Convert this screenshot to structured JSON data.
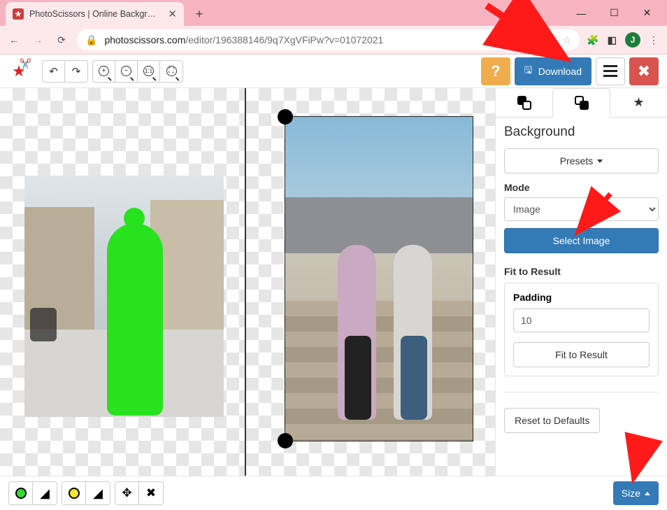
{
  "browser": {
    "tab_title": "PhotoScissors | Online Backgr…",
    "url_domain": "photoscissors.com",
    "url_path": "/editor/196388146/9q7XgVFiPw?v=01072021",
    "avatar_initial": "J"
  },
  "toolbar": {
    "download_label": "Download"
  },
  "sidepanel": {
    "title": "Background",
    "presets_label": "Presets",
    "mode_label": "Mode",
    "mode_value": "Image",
    "select_image_label": "Select Image",
    "fit_section_label": "Fit to Result",
    "padding_label": "Padding",
    "padding_value": "10",
    "fit_button_label": "Fit to Result",
    "reset_label": "Reset to Defaults"
  },
  "bottombar": {
    "size_label": "Size"
  }
}
